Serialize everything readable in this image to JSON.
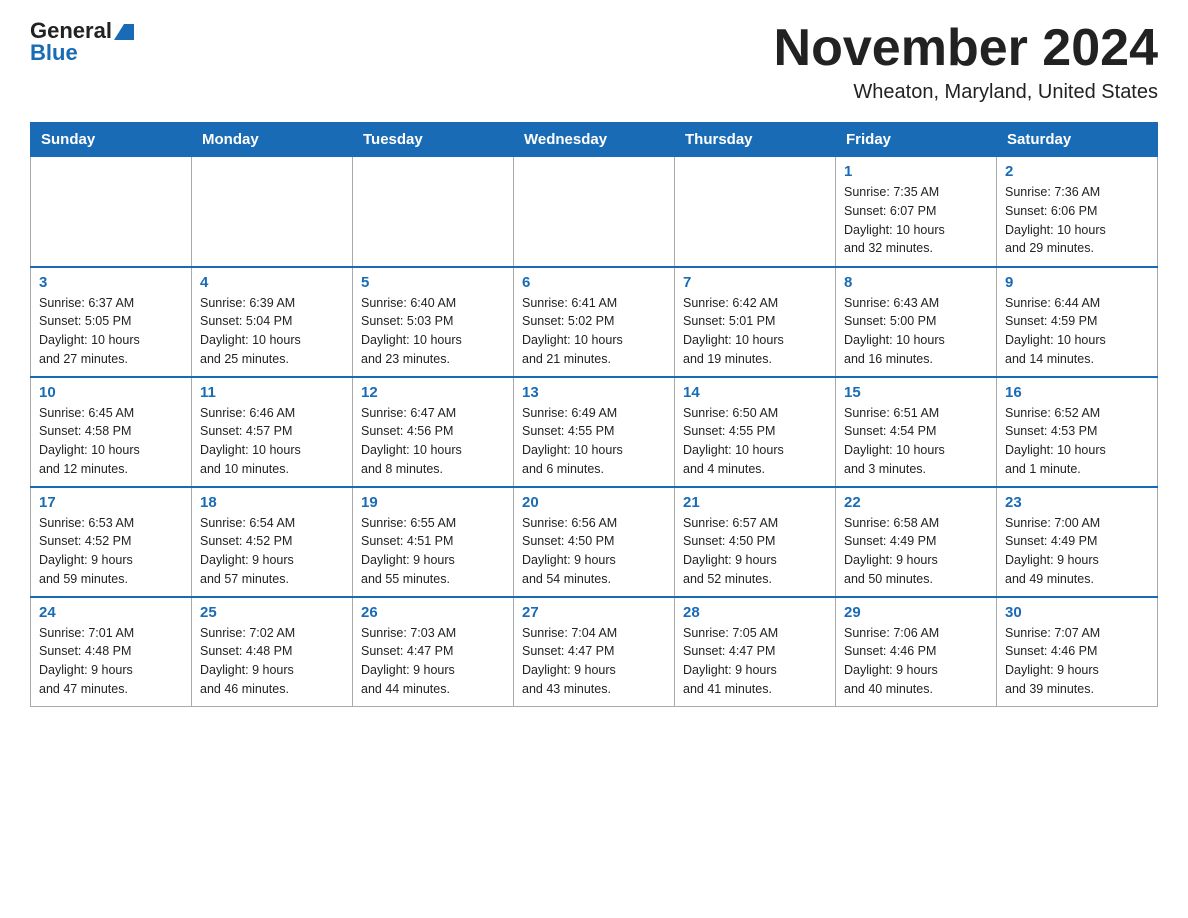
{
  "header": {
    "logo_general": "General",
    "logo_blue": "Blue",
    "month_title": "November 2024",
    "location": "Wheaton, Maryland, United States"
  },
  "weekdays": [
    "Sunday",
    "Monday",
    "Tuesday",
    "Wednesday",
    "Thursday",
    "Friday",
    "Saturday"
  ],
  "weeks": [
    [
      {
        "day": "",
        "info": ""
      },
      {
        "day": "",
        "info": ""
      },
      {
        "day": "",
        "info": ""
      },
      {
        "day": "",
        "info": ""
      },
      {
        "day": "",
        "info": ""
      },
      {
        "day": "1",
        "info": "Sunrise: 7:35 AM\nSunset: 6:07 PM\nDaylight: 10 hours\nand 32 minutes."
      },
      {
        "day": "2",
        "info": "Sunrise: 7:36 AM\nSunset: 6:06 PM\nDaylight: 10 hours\nand 29 minutes."
      }
    ],
    [
      {
        "day": "3",
        "info": "Sunrise: 6:37 AM\nSunset: 5:05 PM\nDaylight: 10 hours\nand 27 minutes."
      },
      {
        "day": "4",
        "info": "Sunrise: 6:39 AM\nSunset: 5:04 PM\nDaylight: 10 hours\nand 25 minutes."
      },
      {
        "day": "5",
        "info": "Sunrise: 6:40 AM\nSunset: 5:03 PM\nDaylight: 10 hours\nand 23 minutes."
      },
      {
        "day": "6",
        "info": "Sunrise: 6:41 AM\nSunset: 5:02 PM\nDaylight: 10 hours\nand 21 minutes."
      },
      {
        "day": "7",
        "info": "Sunrise: 6:42 AM\nSunset: 5:01 PM\nDaylight: 10 hours\nand 19 minutes."
      },
      {
        "day": "8",
        "info": "Sunrise: 6:43 AM\nSunset: 5:00 PM\nDaylight: 10 hours\nand 16 minutes."
      },
      {
        "day": "9",
        "info": "Sunrise: 6:44 AM\nSunset: 4:59 PM\nDaylight: 10 hours\nand 14 minutes."
      }
    ],
    [
      {
        "day": "10",
        "info": "Sunrise: 6:45 AM\nSunset: 4:58 PM\nDaylight: 10 hours\nand 12 minutes."
      },
      {
        "day": "11",
        "info": "Sunrise: 6:46 AM\nSunset: 4:57 PM\nDaylight: 10 hours\nand 10 minutes."
      },
      {
        "day": "12",
        "info": "Sunrise: 6:47 AM\nSunset: 4:56 PM\nDaylight: 10 hours\nand 8 minutes."
      },
      {
        "day": "13",
        "info": "Sunrise: 6:49 AM\nSunset: 4:55 PM\nDaylight: 10 hours\nand 6 minutes."
      },
      {
        "day": "14",
        "info": "Sunrise: 6:50 AM\nSunset: 4:55 PM\nDaylight: 10 hours\nand 4 minutes."
      },
      {
        "day": "15",
        "info": "Sunrise: 6:51 AM\nSunset: 4:54 PM\nDaylight: 10 hours\nand 3 minutes."
      },
      {
        "day": "16",
        "info": "Sunrise: 6:52 AM\nSunset: 4:53 PM\nDaylight: 10 hours\nand 1 minute."
      }
    ],
    [
      {
        "day": "17",
        "info": "Sunrise: 6:53 AM\nSunset: 4:52 PM\nDaylight: 9 hours\nand 59 minutes."
      },
      {
        "day": "18",
        "info": "Sunrise: 6:54 AM\nSunset: 4:52 PM\nDaylight: 9 hours\nand 57 minutes."
      },
      {
        "day": "19",
        "info": "Sunrise: 6:55 AM\nSunset: 4:51 PM\nDaylight: 9 hours\nand 55 minutes."
      },
      {
        "day": "20",
        "info": "Sunrise: 6:56 AM\nSunset: 4:50 PM\nDaylight: 9 hours\nand 54 minutes."
      },
      {
        "day": "21",
        "info": "Sunrise: 6:57 AM\nSunset: 4:50 PM\nDaylight: 9 hours\nand 52 minutes."
      },
      {
        "day": "22",
        "info": "Sunrise: 6:58 AM\nSunset: 4:49 PM\nDaylight: 9 hours\nand 50 minutes."
      },
      {
        "day": "23",
        "info": "Sunrise: 7:00 AM\nSunset: 4:49 PM\nDaylight: 9 hours\nand 49 minutes."
      }
    ],
    [
      {
        "day": "24",
        "info": "Sunrise: 7:01 AM\nSunset: 4:48 PM\nDaylight: 9 hours\nand 47 minutes."
      },
      {
        "day": "25",
        "info": "Sunrise: 7:02 AM\nSunset: 4:48 PM\nDaylight: 9 hours\nand 46 minutes."
      },
      {
        "day": "26",
        "info": "Sunrise: 7:03 AM\nSunset: 4:47 PM\nDaylight: 9 hours\nand 44 minutes."
      },
      {
        "day": "27",
        "info": "Sunrise: 7:04 AM\nSunset: 4:47 PM\nDaylight: 9 hours\nand 43 minutes."
      },
      {
        "day": "28",
        "info": "Sunrise: 7:05 AM\nSunset: 4:47 PM\nDaylight: 9 hours\nand 41 minutes."
      },
      {
        "day": "29",
        "info": "Sunrise: 7:06 AM\nSunset: 4:46 PM\nDaylight: 9 hours\nand 40 minutes."
      },
      {
        "day": "30",
        "info": "Sunrise: 7:07 AM\nSunset: 4:46 PM\nDaylight: 9 hours\nand 39 minutes."
      }
    ]
  ]
}
